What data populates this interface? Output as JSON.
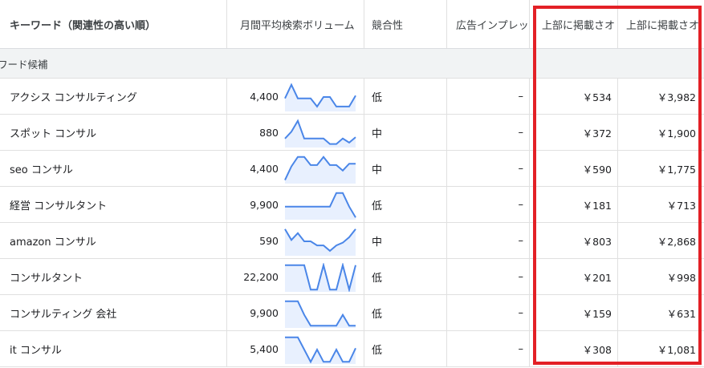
{
  "header": {
    "keyword": "キーワード（関連性の高い順）",
    "volume": "月間平均検索ボリューム",
    "competition": "競合性",
    "impression": "広告インプレッ",
    "top_low": "上部に掲載さオ",
    "top_high": "上部に掲載さオ"
  },
  "group_label": "ワード候補",
  "rows": [
    {
      "keyword": "アクシス コンサルティング",
      "volume": "4,400",
      "competition": "低",
      "impression": "–",
      "low": "￥534",
      "high": "￥3,982",
      "trend": [
        0.55,
        0.05,
        0.55,
        0.55,
        0.55,
        0.85,
        0.5,
        0.5,
        0.85,
        0.85,
        0.85,
        0.45
      ]
    },
    {
      "keyword": "スポット コンサル",
      "volume": "880",
      "competition": "中",
      "impression": "–",
      "low": "￥372",
      "high": "￥1,900",
      "trend": [
        0.7,
        0.45,
        0.05,
        0.7,
        0.7,
        0.7,
        0.7,
        0.9,
        0.9,
        0.7,
        0.85,
        0.65
      ]
    },
    {
      "keyword": "seo コンサル",
      "volume": "4,400",
      "competition": "中",
      "impression": "–",
      "low": "￥590",
      "high": "￥1,775",
      "trend": [
        0.9,
        0.4,
        0.05,
        0.05,
        0.35,
        0.35,
        0.05,
        0.35,
        0.35,
        0.55,
        0.3,
        0.3
      ]
    },
    {
      "keyword": "経営 コンサルタント",
      "volume": "9,900",
      "competition": "低",
      "impression": "–",
      "low": "￥181",
      "high": "￥713",
      "trend": [
        0.55,
        0.55,
        0.55,
        0.55,
        0.55,
        0.55,
        0.55,
        0.55,
        0.05,
        0.05,
        0.55,
        0.95
      ]
    },
    {
      "keyword": "amazon コンサル",
      "volume": "590",
      "competition": "中",
      "impression": "–",
      "low": "￥803",
      "high": "￥2,868",
      "trend": [
        0.05,
        0.45,
        0.2,
        0.5,
        0.5,
        0.65,
        0.65,
        0.85,
        0.65,
        0.55,
        0.35,
        0.05
      ]
    },
    {
      "keyword": "コンサルタント",
      "volume": "22,200",
      "competition": "低",
      "impression": "–",
      "low": "￥201",
      "high": "￥998",
      "trend": [
        0.05,
        0.05,
        0.05,
        0.05,
        0.95,
        0.95,
        0.05,
        0.95,
        0.95,
        0.05,
        0.95,
        0.05
      ]
    },
    {
      "keyword": "コンサルティング 会社",
      "volume": "9,900",
      "competition": "低",
      "impression": "–",
      "low": "￥159",
      "high": "￥631",
      "trend": [
        0.05,
        0.05,
        0.05,
        0.55,
        0.95,
        0.95,
        0.95,
        0.95,
        0.95,
        0.55,
        0.95,
        0.95
      ]
    },
    {
      "keyword": "it コンサル",
      "volume": "5,400",
      "competition": "低",
      "impression": "–",
      "low": "￥308",
      "high": "￥1,081",
      "trend": [
        0.05,
        0.05,
        0.05,
        0.5,
        0.95,
        0.5,
        0.95,
        0.95,
        0.5,
        0.95,
        0.95,
        0.45
      ]
    }
  ],
  "colors": {
    "sparkline": "#4a86e8",
    "sparkfill": "#e8f0fe",
    "highlight": "#e32026"
  }
}
